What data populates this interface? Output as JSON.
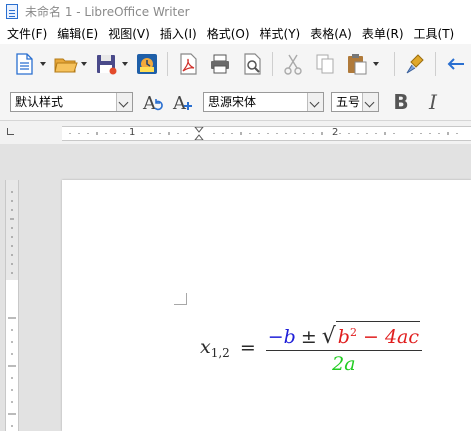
{
  "window": {
    "title": "未命名 1 - LibreOffice Writer"
  },
  "menu": [
    "文件(F)",
    "编辑(E)",
    "视图(V)",
    "插入(I)",
    "格式(O)",
    "样式(Y)",
    "表格(A)",
    "表单(R)",
    "工具(T)"
  ],
  "toolbar": {
    "icons": [
      "new-document-icon",
      "open-folder-icon",
      "save-icon",
      "export-directly-icon",
      "export-pdf-icon",
      "print-icon",
      "print-preview-icon",
      "cut-icon",
      "copy-icon",
      "paste-icon",
      "clone-formatting-icon",
      "undo-icon"
    ]
  },
  "format_bar": {
    "paragraph_style": "默认样式",
    "font_name": "思源宋体",
    "font_size": "五号",
    "bold_label": "B",
    "italic_label": "I"
  },
  "ruler": {
    "labels": [
      "1",
      "2"
    ]
  },
  "formula": {
    "lhs_var": "x",
    "lhs_sub": "1,2",
    "equals": "=",
    "minus_b": "−b",
    "plus_minus": "±",
    "sqrt_symbol": "√",
    "radicand_b": "b",
    "radicand_exp": "2",
    "radicand_rest": " − 4ac",
    "denominator": "2a"
  },
  "colors": {
    "numerator_b": "#1f1fd8",
    "radicand": "#e01e1e",
    "denominator": "#22cc22"
  }
}
